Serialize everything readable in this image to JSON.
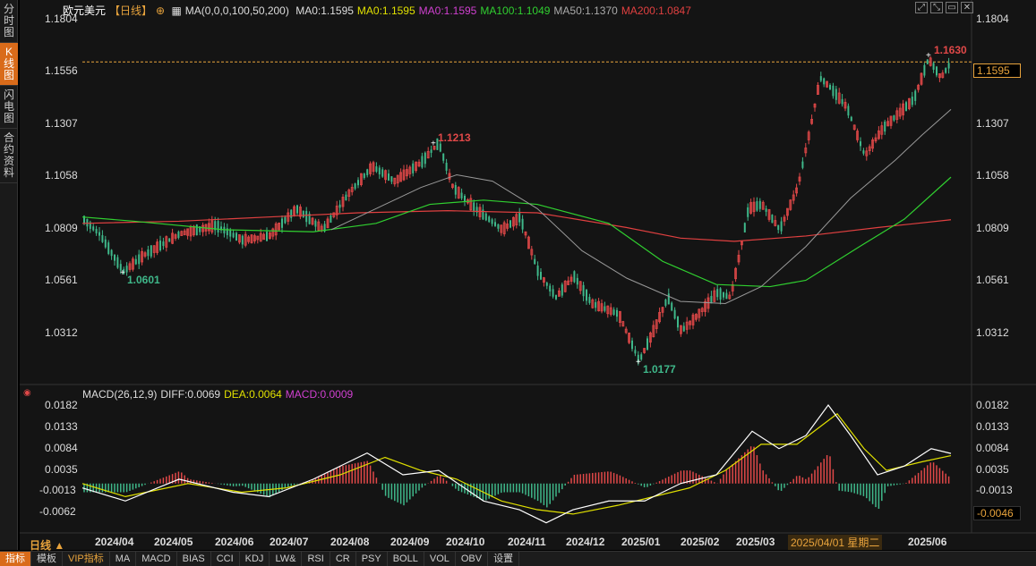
{
  "sidebar": {
    "tabs": [
      {
        "label": "分时图",
        "active": false
      },
      {
        "label": "K线图",
        "active": true
      },
      {
        "label": "闪电图",
        "active": false
      },
      {
        "label": "合约资料",
        "active": false
      }
    ]
  },
  "header": {
    "symbol": "欧元美元",
    "period": "【日线】",
    "period_icon": "plus-circle-icon",
    "ma_params": "MA(0,0,0,100,50,200)",
    "ma_values": [
      {
        "label": "MA0:1.1595",
        "color": "#dddddd"
      },
      {
        "label": "MA0:1.1595",
        "color": "#e0e000"
      },
      {
        "label": "MA0:1.1595",
        "color": "#d040d0"
      },
      {
        "label": "MA100:1.1049",
        "color": "#30d030"
      },
      {
        "label": "MA50:1.1370",
        "color": "#aaaaaa"
      },
      {
        "label": "MA200:1.0847",
        "color": "#e04040"
      }
    ]
  },
  "window_buttons": [
    "expand-icon",
    "shrink-icon",
    "restore-icon",
    "close-icon"
  ],
  "price_axis": {
    "left_labels": [
      "1.1804",
      "1.1556",
      "1.1307",
      "1.1058",
      "1.0809",
      "1.0561",
      "1.0312"
    ],
    "right_labels": [
      "1.1804",
      "1.1307",
      "1.1058",
      "1.0809",
      "1.0561",
      "1.0312"
    ],
    "current_price": "1.1595"
  },
  "annotations": {
    "high_recent": "1.1630",
    "high_mid": "1.1213",
    "low_left": "1.0601",
    "low_mid": "1.0177"
  },
  "macd": {
    "params": "MACD(26,12,9)",
    "diff": "DIFF:0.0069",
    "dea": "DEA:0.0064",
    "macd": "MACD:0.0009",
    "axis_left": [
      "0.0182",
      "0.0133",
      "0.0084",
      "0.0035",
      "-0.0013",
      "-0.0062"
    ],
    "axis_right": [
      "0.0182",
      "0.0133",
      "0.0084",
      "0.0035",
      "-0.0013"
    ],
    "cursor_value": "-0.0046"
  },
  "dates": [
    "2024/04",
    "2024/05",
    "2024/06",
    "2024/07",
    "2024/08",
    "2024/09",
    "2024/10",
    "2024/11",
    "2024/12",
    "2025/01",
    "2025/02",
    "2025/03",
    "2025/06"
  ],
  "date_highlight": "2025/04/01 星期二",
  "period_label": "日线 ▲",
  "bottom_tabs": [
    {
      "label": "指标",
      "active": true,
      "vip": false
    },
    {
      "label": "模板",
      "active": false,
      "vip": false
    },
    {
      "label": "VIP指标",
      "active": false,
      "vip": true
    },
    {
      "label": "MA",
      "active": false,
      "vip": false
    },
    {
      "label": "MACD",
      "active": false,
      "vip": false
    },
    {
      "label": "BIAS",
      "active": false,
      "vip": false
    },
    {
      "label": "CCI",
      "active": false,
      "vip": false
    },
    {
      "label": "KDJ",
      "active": false,
      "vip": false
    },
    {
      "label": "LW&",
      "active": false,
      "vip": false
    },
    {
      "label": "RSI",
      "active": false,
      "vip": false
    },
    {
      "label": "CR",
      "active": false,
      "vip": false
    },
    {
      "label": "PSY",
      "active": false,
      "vip": false
    },
    {
      "label": "BOLL",
      "active": false,
      "vip": false
    },
    {
      "label": "VOL",
      "active": false,
      "vip": false
    },
    {
      "label": "OBV",
      "active": false,
      "vip": false
    },
    {
      "label": "设置",
      "active": false,
      "vip": false
    }
  ],
  "colors": {
    "up": "#e04848",
    "down": "#3fb88a",
    "ma100": "#30d030",
    "ma50": "#999999",
    "ma200": "#e04040",
    "diff": "#ffffff",
    "dea": "#e0e000",
    "accent": "#e8a33c"
  }
}
